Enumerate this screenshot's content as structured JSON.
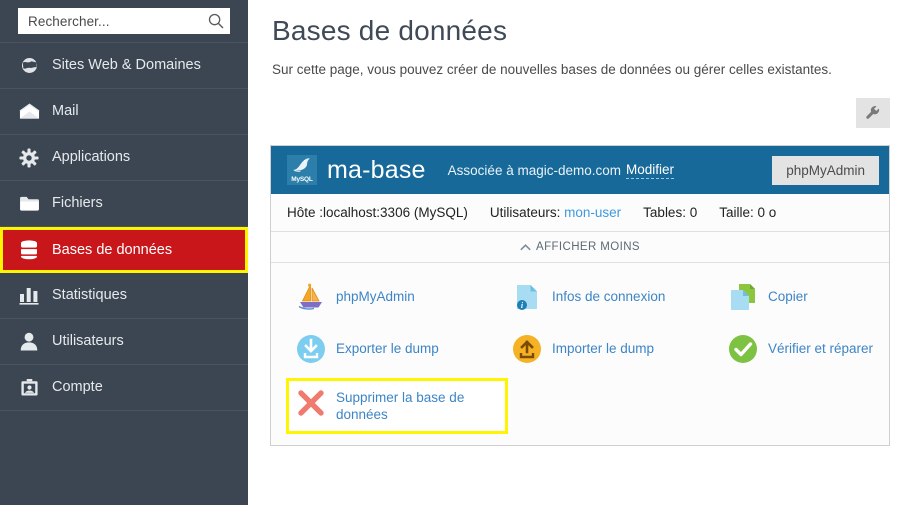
{
  "sidebar": {
    "search": {
      "placeholder": "Rechercher...",
      "icon": "search-icon"
    },
    "items": [
      {
        "label": "Sites Web & Domaines",
        "icon": "globe-icon",
        "active": false
      },
      {
        "label": "Mail",
        "icon": "envelope-icon",
        "active": false
      },
      {
        "label": "Applications",
        "icon": "gear-icon",
        "active": false
      },
      {
        "label": "Fichiers",
        "icon": "folder-icon",
        "active": false
      },
      {
        "label": "Bases de données",
        "icon": "database-icon",
        "active": true
      },
      {
        "label": "Statistiques",
        "icon": "bar-chart-icon",
        "active": false
      },
      {
        "label": "Utilisateurs",
        "icon": "user-icon",
        "active": false
      },
      {
        "label": "Compte",
        "icon": "briefcase-icon",
        "active": false
      }
    ]
  },
  "main": {
    "title": "Bases de données",
    "subtitle": "Sur cette page, vous pouvez créer de nouvelles bases de données ou gérer celles existantes.",
    "tools_button_icon": "wrench-icon"
  },
  "database": {
    "logo_text": "MySQL",
    "name": "ma-base",
    "association_text": "Associée à magic-demo.com",
    "modify_link": "Modifier",
    "phpmyadmin_button": "phpMyAdmin",
    "info": {
      "host": "Hôte :localhost:3306 (MySQL)",
      "users_label": "Utilisateurs:",
      "users_value": "mon-user",
      "tables": "Tables: 0",
      "size": "Taille: 0 o"
    },
    "show_less_label": "AFFICHER MOINS",
    "actions": [
      {
        "label": "phpMyAdmin",
        "icon": "phpmyadmin-boat-icon"
      },
      {
        "label": "Infos de connexion",
        "icon": "document-info-icon"
      },
      {
        "label": "Copier",
        "icon": "copy-documents-icon"
      },
      {
        "label": "Exporter le dump",
        "icon": "download-circle-icon"
      },
      {
        "label": "Importer le dump",
        "icon": "upload-circle-icon"
      },
      {
        "label": "Vérifier et réparer",
        "icon": "check-circle-icon"
      },
      {
        "label": "Supprimer la base de données",
        "icon": "red-cross-icon"
      }
    ]
  },
  "colors": {
    "sidebar_bg": "#3b4652",
    "active_item_bg": "#c8161a",
    "highlight_outline": "#fff500",
    "db_header_blue": "#17699a",
    "link_blue": "#3d85c6"
  }
}
